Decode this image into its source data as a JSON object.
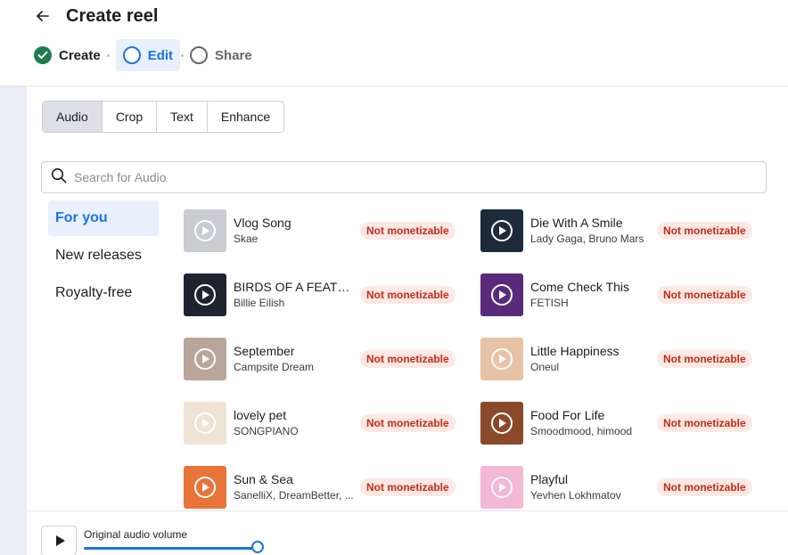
{
  "header": {
    "title": "Create reel",
    "steps": [
      {
        "label": "Create",
        "state": "done"
      },
      {
        "label": "Edit",
        "state": "current"
      },
      {
        "label": "Share",
        "state": "pending"
      }
    ]
  },
  "editor_tabs": [
    "Audio",
    "Crop",
    "Text",
    "Enhance"
  ],
  "active_tab": "Audio",
  "search": {
    "placeholder": "Search for Audio",
    "value": ""
  },
  "categories": [
    {
      "label": "For you",
      "active": true
    },
    {
      "label": "New releases",
      "active": false
    },
    {
      "label": "Royalty-free",
      "active": false
    }
  ],
  "tracks": [
    {
      "title": "Vlog Song",
      "artist": "Skae",
      "badge": "Not monetizable",
      "thumb_color": "#c9ccd1"
    },
    {
      "title": "Die With A Smile",
      "artist": "Lady Gaga, Bruno Mars",
      "badge": "Not monetizable",
      "thumb_color": "#1c2a3a"
    },
    {
      "title": "BIRDS OF A FEATHER",
      "artist": "Billie Eilish",
      "badge": "Not monetizable",
      "thumb_color": "#1d2430"
    },
    {
      "title": "Come Check This",
      "artist": "FETISH",
      "badge": "Not monetizable",
      "thumb_color": "#5a2a7a"
    },
    {
      "title": "September",
      "artist": "Campsite Dream",
      "badge": "Not monetizable",
      "thumb_color": "#b9a59a"
    },
    {
      "title": "Little Happiness",
      "artist": "Oneul",
      "badge": "Not monetizable",
      "thumb_color": "#e8c2a4"
    },
    {
      "title": "lovely pet",
      "artist": "SONGPIANO",
      "badge": "Not monetizable",
      "thumb_color": "#efe3d3"
    },
    {
      "title": "Food For Life",
      "artist": "Smoodmood, himood",
      "badge": "Not monetizable",
      "thumb_color": "#8a4a2a"
    },
    {
      "title": "Sun & Sea",
      "artist": "SanelliX, DreamBetter, ...",
      "badge": "Not monetizable",
      "thumb_color": "#e8743a"
    },
    {
      "title": "Playful",
      "artist": "Yevhen Lokhmatov",
      "badge": "Not monetizable",
      "thumb_color": "#f2b8d4"
    }
  ],
  "bottom_bar": {
    "volume_label": "Original audio volume",
    "volume_fraction": 1.0
  },
  "colors": {
    "accent": "#1b74e4",
    "done": "#1f7a4d",
    "badge_text": "#c4281c",
    "badge_bg": "#fde9e4"
  }
}
